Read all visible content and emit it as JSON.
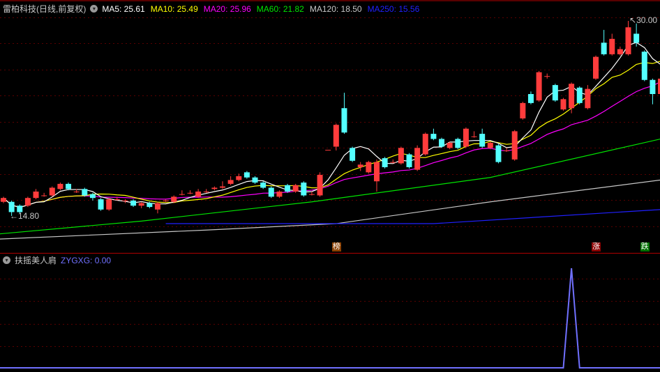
{
  "header": {
    "title": "雷柏科技(日线,前复权)",
    "ma": [
      {
        "label": "MA5: 25.61",
        "color": "#ffffff"
      },
      {
        "label": "MA10: 25.49",
        "color": "#ffff00"
      },
      {
        "label": "MA20: 25.96",
        "color": "#ff00ff"
      },
      {
        "label": "MA60: 21.82",
        "color": "#00e600"
      },
      {
        "label": "MA120: 18.50",
        "color": "#c8c8c8"
      },
      {
        "label": "MA250: 15.56",
        "color": "#2020ff"
      }
    ]
  },
  "indicator": {
    "name": "扶摇美人肩",
    "value_label": "ZYGXG: 0.00",
    "color": "#7070ff"
  },
  "price_labels": {
    "high": "30.00",
    "low": "14.80"
  },
  "markers": [
    {
      "text": "榜",
      "index": 41,
      "color": "#8b4000"
    },
    {
      "text": "涨",
      "index": 73,
      "color": "#8b0000"
    },
    {
      "text": "跌",
      "index": 79,
      "color": "#007000"
    }
  ],
  "colors": {
    "up": "#ff3c3c",
    "down": "#54ffff",
    "grid": "#5a0000",
    "border": "#b00000"
  },
  "chart_data": {
    "type": "candlestick",
    "yrange": [
      11.0,
      31.4
    ],
    "candles_ochl": [
      [
        15.9,
        16.2,
        16.3,
        15.8
      ],
      [
        15.9,
        15.1,
        16.0,
        14.8
      ],
      [
        15.6,
        15.1,
        15.7,
        15.0
      ],
      [
        15.6,
        16.2,
        16.3,
        15.5
      ],
      [
        16.2,
        16.7,
        16.9,
        16.1
      ],
      [
        16.4,
        16.4,
        16.6,
        16.3
      ],
      [
        16.4,
        17.0,
        17.1,
        16.3
      ],
      [
        16.9,
        17.3,
        17.4,
        16.8
      ],
      [
        17.3,
        16.9,
        17.4,
        16.8
      ],
      [
        16.7,
        16.7,
        16.9,
        16.6
      ],
      [
        16.9,
        16.4,
        17.0,
        16.3
      ],
      [
        16.5,
        16.2,
        16.6,
        16.0
      ],
      [
        16.1,
        15.3,
        16.2,
        15.2
      ],
      [
        15.3,
        16.1,
        16.2,
        15.2
      ],
      [
        16.1,
        16.1,
        16.3,
        16.0
      ],
      [
        16.0,
        16.0,
        16.1,
        15.8
      ],
      [
        16.0,
        15.6,
        16.1,
        15.5
      ],
      [
        15.6,
        15.8,
        15.9,
        15.4
      ],
      [
        15.8,
        15.5,
        15.9,
        15.4
      ],
      [
        15.3,
        15.8,
        15.9,
        15.0
      ],
      [
        16.0,
        16.0,
        16.1,
        15.9
      ],
      [
        15.9,
        16.3,
        16.4,
        15.8
      ],
      [
        16.5,
        16.5,
        16.8,
        16.4
      ],
      [
        16.6,
        16.6,
        16.8,
        16.5
      ],
      [
        16.3,
        16.7,
        16.9,
        16.2
      ],
      [
        16.7,
        16.7,
        16.9,
        16.6
      ],
      [
        16.9,
        17.0,
        17.1,
        16.8
      ],
      [
        17.0,
        17.1,
        17.5,
        16.9
      ],
      [
        17.3,
        17.6,
        17.9,
        17.2
      ],
      [
        17.6,
        17.9,
        18.1,
        17.5
      ],
      [
        18.2,
        17.8,
        18.3,
        17.7
      ],
      [
        17.8,
        17.4,
        17.9,
        17.3
      ],
      [
        17.4,
        17.0,
        17.5,
        16.9
      ],
      [
        17.0,
        16.3,
        17.1,
        16.2
      ],
      [
        16.3,
        16.7,
        16.8,
        16.2
      ],
      [
        17.2,
        16.7,
        17.3,
        16.6
      ],
      [
        16.7,
        17.2,
        17.3,
        16.6
      ],
      [
        17.4,
        16.4,
        17.5,
        16.3
      ],
      [
        16.5,
        16.5,
        16.7,
        16.4
      ],
      [
        16.4,
        18.0,
        18.2,
        16.3
      ],
      [
        19.95,
        19.95,
        19.95,
        19.95
      ],
      [
        20.2,
        21.9,
        22.0,
        19.9
      ],
      [
        23.2,
        21.3,
        24.4,
        21.2
      ],
      [
        20.1,
        19.1,
        20.2,
        19.0
      ],
      [
        18.6,
        18.8,
        19.0,
        18.3
      ],
      [
        18.2,
        19.0,
        19.1,
        18.1
      ],
      [
        17.5,
        19.0,
        19.2,
        16.7
      ],
      [
        19.3,
        18.6,
        19.4,
        18.5
      ],
      [
        19.0,
        19.0,
        19.2,
        18.9
      ],
      [
        18.9,
        20.1,
        20.2,
        18.8
      ],
      [
        19.6,
        18.6,
        19.7,
        18.5
      ],
      [
        18.4,
        20.1,
        20.3,
        18.3
      ],
      [
        19.6,
        21.2,
        21.3,
        19.5
      ],
      [
        21.2,
        20.8,
        21.6,
        20.7
      ],
      [
        20.8,
        20.2,
        20.9,
        20.1
      ],
      [
        20.1,
        20.5,
        20.6,
        20.0
      ],
      [
        20.8,
        20.1,
        20.9,
        20.0
      ],
      [
        20.2,
        21.6,
        21.7,
        20.1
      ],
      [
        21.0,
        21.0,
        21.4,
        20.9
      ],
      [
        21.2,
        20.2,
        21.6,
        20.1
      ],
      [
        20.1,
        20.5,
        20.6,
        20.0
      ],
      [
        20.3,
        19.0,
        20.4,
        18.9
      ],
      [
        19.9,
        19.9,
        20.1,
        19.8
      ],
      [
        19.2,
        21.4,
        21.5,
        19.1
      ],
      [
        22.4,
        23.6,
        23.7,
        22.3
      ],
      [
        24.3,
        23.6,
        24.5,
        23.5
      ],
      [
        23.8,
        26.0,
        26.1,
        23.7
      ],
      [
        25.7,
        25.7,
        25.9,
        25.5
      ],
      [
        25.0,
        23.8,
        25.1,
        23.7
      ],
      [
        23.1,
        23.9,
        24.0,
        23.0
      ],
      [
        23.2,
        25.1,
        25.2,
        22.8
      ],
      [
        24.8,
        23.6,
        24.9,
        23.5
      ],
      [
        23.2,
        24.7,
        25.0,
        23.1
      ],
      [
        25.5,
        27.2,
        27.3,
        25.4
      ],
      [
        28.3,
        27.4,
        29.3,
        27.3
      ],
      [
        27.4,
        28.6,
        29.0,
        27.3
      ],
      [
        27.4,
        27.8,
        28.0,
        27.3
      ],
      [
        27.4,
        29.5,
        30.0,
        27.3
      ],
      [
        29.0,
        28.3,
        29.8,
        28.0
      ],
      [
        27.6,
        25.4,
        27.7,
        25.3
      ],
      [
        25.4,
        24.3,
        25.5,
        23.5
      ],
      [
        24.3,
        25.5,
        25.6,
        24.2
      ]
    ],
    "long_ma": [
      {
        "name": "MA60",
        "points": [
          [
            0,
            13.4
          ],
          [
            17,
            14.4
          ],
          [
            38,
            15.9
          ],
          [
            60,
            17.8
          ],
          [
            81,
            20.8
          ]
        ]
      },
      {
        "name": "MA120",
        "points": [
          [
            0,
            13.0
          ],
          [
            25,
            13.7
          ],
          [
            41,
            14.2
          ],
          [
            60,
            15.9
          ],
          [
            81,
            17.6
          ]
        ]
      },
      {
        "name": "MA250",
        "points": [
          [
            20,
            14.2
          ],
          [
            53,
            14.2
          ],
          [
            81,
            15.3
          ]
        ]
      }
    ],
    "indicator_series": {
      "name": "ZYGXG",
      "range": [
        0,
        1.05
      ],
      "spike_index": 70,
      "spike_value": 1
    }
  }
}
